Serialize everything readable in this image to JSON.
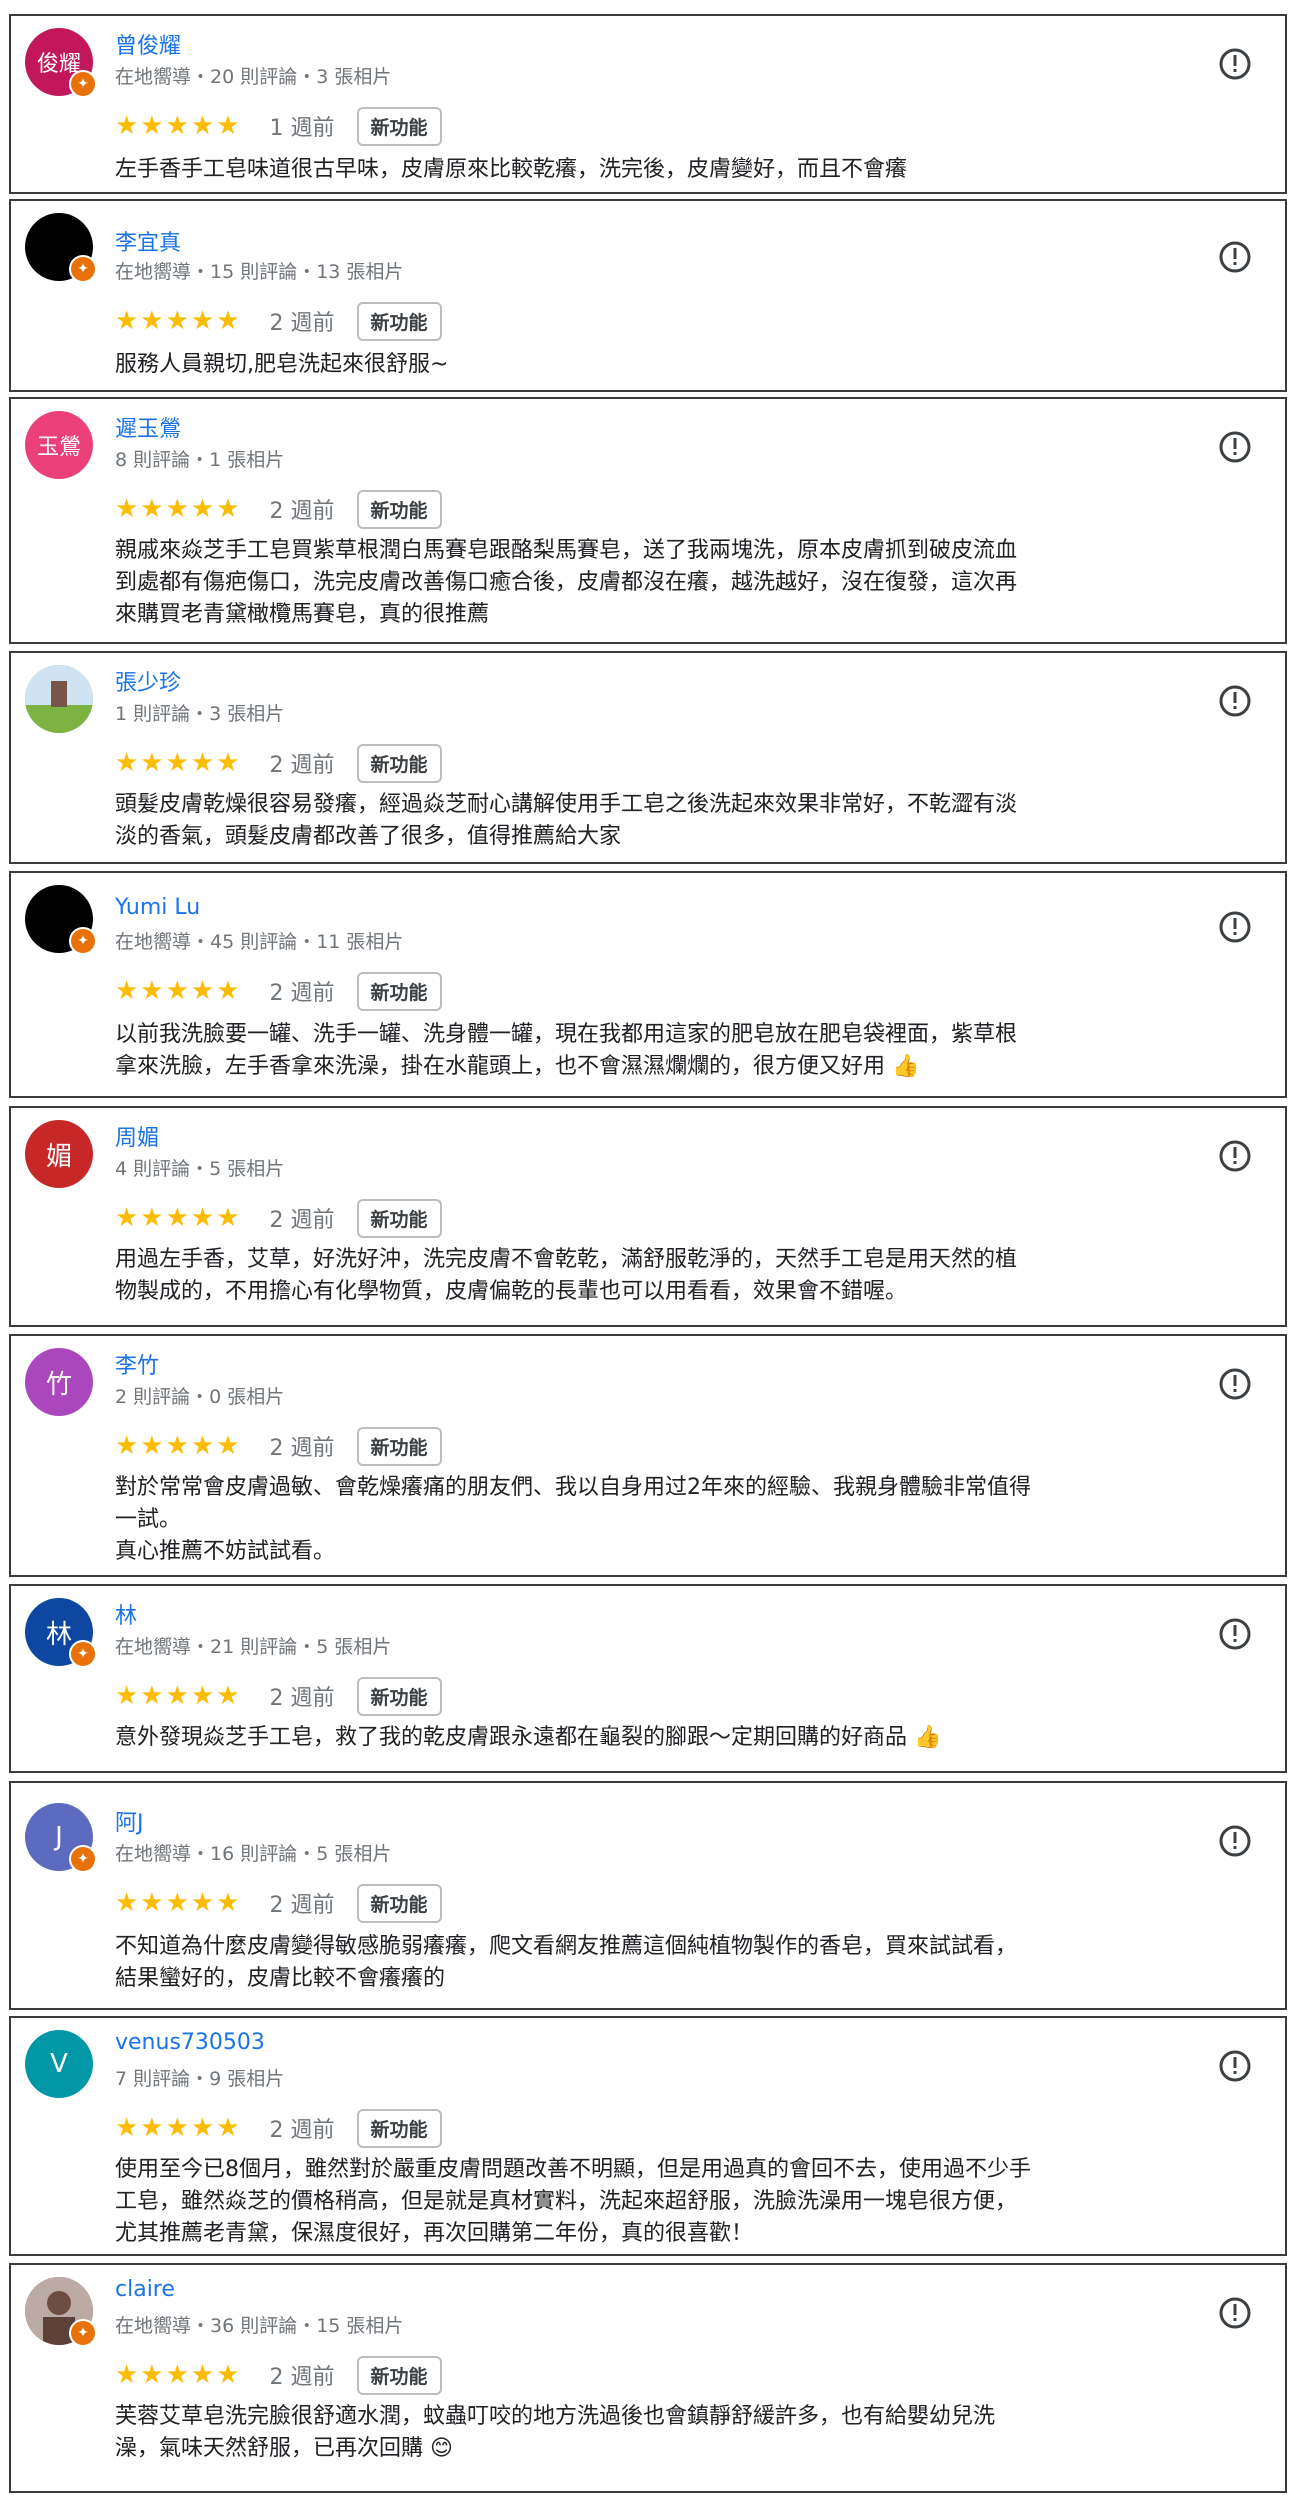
{
  "new_feature_label": "新功能",
  "stars": "★★★★★",
  "reviews": [
    {
      "avatar_text": "俊耀",
      "avatar_color": "#c2185b",
      "name": "曾俊耀",
      "meta": "在地嚮導・20 則評論・3 張相片",
      "time": "1 週前",
      "text": "左手香手工皂味道很古早味，皮膚原來比較乾癢，洗完後，皮膚變好，而且不會癢"
    },
    {
      "avatar_text": "",
      "avatar_color": "#000000",
      "name": "李宜真",
      "meta": "在地嚮導・15 則評論・13 張相片",
      "time": "2 週前",
      "text": "服務人員親切,肥皂洗起來很舒服~"
    },
    {
      "avatar_text": "玉鶯",
      "avatar_color": "#ec407a",
      "name": "遲玉鶯",
      "meta": "8 則評論・1 張相片",
      "time": "2 週前",
      "text": "親戚來焱芝手工皂買紫草根潤白馬賽皂跟酪梨馬賽皂，送了我兩塊洗，原本皮膚抓到破皮流血\n到處都有傷疤傷口，洗完皮膚改善傷口癒合後，皮膚都沒在癢，越洗越好，沒在復發，這次再\n來購買老青黛橄欖馬賽皂，真的很推薦"
    },
    {
      "avatar_text": "",
      "avatar_color": "#8bc34a",
      "name": "張少珍",
      "meta": "1 則評論・3 張相片",
      "time": "2 週前",
      "text": "頭髮皮膚乾燥很容易發癢，經過焱芝耐心講解使用手工皂之後洗起來效果非常好，不乾澀有淡\n淡的香氣，頭髮皮膚都改善了很多，值得推薦給大家"
    },
    {
      "avatar_text": "",
      "avatar_color": "#000000",
      "name": "Yumi Lu",
      "meta": "在地嚮導・45 則評論・11 張相片",
      "time": "2 週前",
      "text": "以前我洗臉要一罐、洗手一罐、洗身體一罐，現在我都用這家的肥皂放在肥皂袋裡面，紫草根\n拿來洗臉，左手香拿來洗澡，掛在水龍頭上，也不會濕濕爛爛的，很方便又好用 👍"
    },
    {
      "avatar_text": "媚",
      "avatar_color": "#c62828",
      "name": "周媚",
      "meta": "4 則評論・5 張相片",
      "time": "2 週前",
      "text": "用過左手香，艾草，好洗好沖，洗完皮膚不會乾乾，滿舒服乾淨的，天然手工皂是用天然的植\n物製成的，不用擔心有化學物質，皮膚偏乾的長輩也可以用看看，效果會不錯喔。"
    },
    {
      "avatar_text": "竹",
      "avatar_color": "#ab47bc",
      "name": "李竹",
      "meta": "2 則評論・0 張相片",
      "time": "2 週前",
      "text": "對於常常會皮膚過敏、會乾燥癢痛的朋友們、我以自身用过2年來的經驗、我親身體驗非常值得\n一試。\n真心推薦不妨試試看。"
    },
    {
      "avatar_text": "林",
      "avatar_color": "#0d47a1",
      "name": "林",
      "meta": "在地嚮導・21 則評論・5 張相片",
      "time": "2 週前",
      "text": "意外發現焱芝手工皂，救了我的乾皮膚跟永遠都在龜裂的腳跟～定期回購的好商品 👍"
    },
    {
      "avatar_text": "J",
      "avatar_color": "#5c6bc0",
      "name": "阿J",
      "meta": "在地嚮導・16 則評論・5 張相片",
      "time": "2 週前",
      "text": "不知道為什麼皮膚變得敏感脆弱癢癢，爬文看網友推薦這個純植物製作的香皂，買來試試看，\n結果蠻好的，皮膚比較不會癢癢的"
    },
    {
      "avatar_text": "V",
      "avatar_color": "#0097a7",
      "name": "venus730503",
      "meta": "7 則評論・9 張相片",
      "time": "2 週前",
      "text": "使用至今已8個月，雖然對於嚴重皮膚問題改善不明顯，但是用過真的會回不去，使用過不少手\n工皂，雖然焱芝的價格稍高，但是就是真材實料，洗起來超舒服，洗臉洗澡用一塊皂很方便，\n尤其推薦老青黛，保濕度很好，再次回購第二年份，真的很喜歡！"
    },
    {
      "avatar_text": "",
      "avatar_color": "#8d6e63",
      "name": "claire",
      "meta": "在地嚮導・36 則評論・15 張相片",
      "time": "2 週前",
      "text": "芙蓉艾草皂洗完臉很舒適水潤，蚊蟲叮咬的地方洗過後也會鎮靜舒緩許多，也有給嬰幼兒洗\n澡，氣味天然舒服，已再次回購 😊"
    }
  ]
}
